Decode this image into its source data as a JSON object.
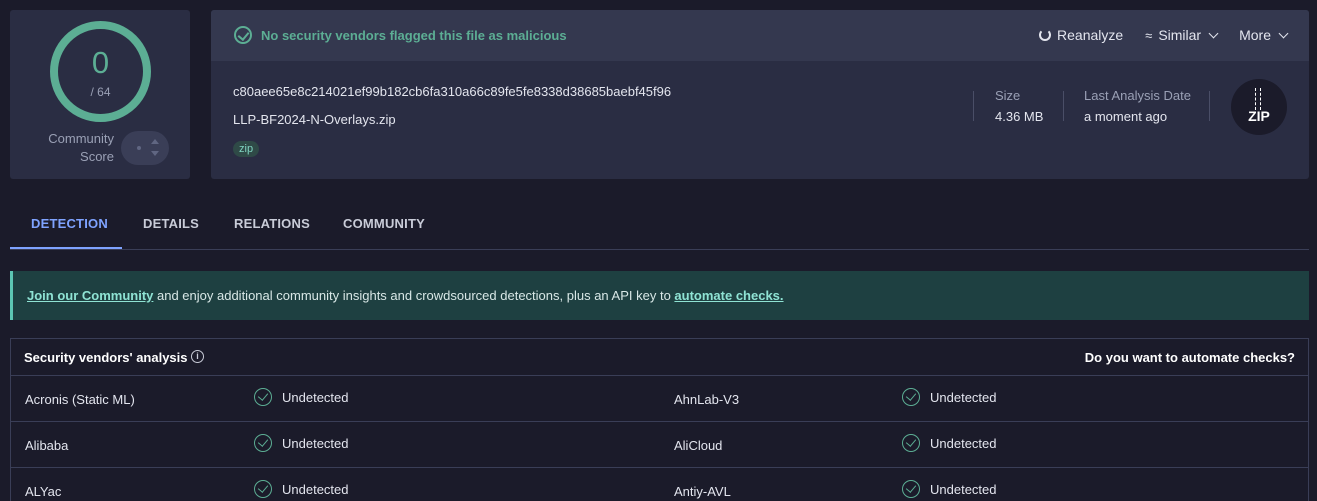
{
  "score": {
    "detections": "0",
    "total": "/ 64",
    "community_label_1": "Community",
    "community_label_2": "Score"
  },
  "banner": {
    "message": "No security vendors flagged this file as malicious"
  },
  "actions": {
    "reanalyze": "Reanalyze",
    "similar": "Similar",
    "more": "More"
  },
  "file": {
    "hash": "c80aee65e8c214021ef99b182cb6fa310a66c89fe5fe8338d38685baebf45f96",
    "name": "LLP-BF2024-N-Overlays.zip",
    "tag": "zip",
    "size_label": "Size",
    "size_value": "4.36 MB",
    "date_label": "Last Analysis Date",
    "date_value": "a moment ago",
    "type_icon_text": "ZIP"
  },
  "tabs": [
    "DETECTION",
    "DETAILS",
    "RELATIONS",
    "COMMUNITY"
  ],
  "join": {
    "link1": "Join our Community",
    "middle": " and enjoy additional community insights and crowdsourced detections, plus an API key to ",
    "link2": "automate checks."
  },
  "vendors": {
    "title": "Security vendors' analysis",
    "automate": "Do you want to automate checks?",
    "rows": [
      {
        "left_name": "Acronis (Static ML)",
        "left_result": "Undetected",
        "right_name": "AhnLab-V3",
        "right_result": "Undetected"
      },
      {
        "left_name": "Alibaba",
        "left_result": "Undetected",
        "right_name": "AliCloud",
        "right_result": "Undetected"
      },
      {
        "left_name": "ALYac",
        "left_result": "Undetected",
        "right_name": "Antiy-AVL",
        "right_result": "Undetected"
      }
    ]
  },
  "colors": {
    "accent_green": "#5cae94",
    "tab_active": "#7fa3ff",
    "background": "#1b1b2a",
    "card": "#2a2d43"
  }
}
